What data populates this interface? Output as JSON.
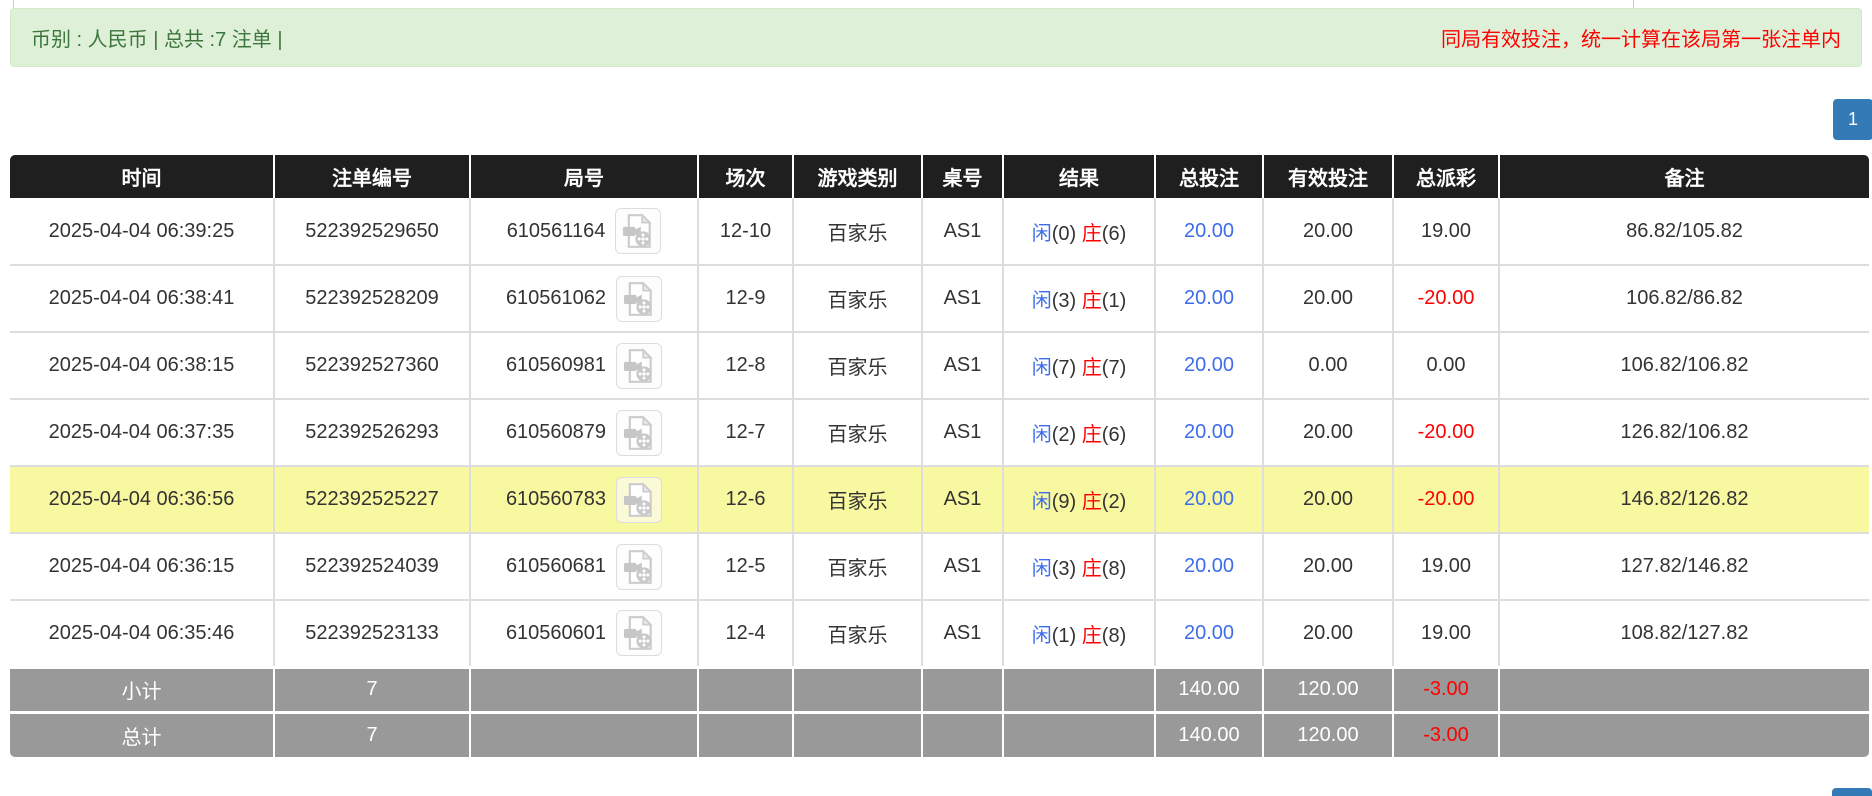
{
  "top_bar": {
    "left_text": "币别 : 人民币 | 总共 :7 注单 |",
    "right_text": "同局有效投注，统一计算在该局第一张注单内"
  },
  "pagination": {
    "current_page": "1"
  },
  "table": {
    "headers": [
      "时间",
      "注单编号",
      "局号",
      "场次",
      "游戏类别",
      "桌号",
      "结果",
      "总投注",
      "有效投注",
      "总派彩",
      "备注"
    ],
    "result_labels": {
      "player": "闲",
      "banker": "庄"
    },
    "rows": [
      {
        "time": "2025-04-04 06:39:25",
        "bet_id": "522392529650",
        "round_id": "610561164",
        "session": "12-10",
        "game_type": "百家乐",
        "table_no": "AS1",
        "player_points": "0",
        "banker_points": "6",
        "total_bet": "20.00",
        "valid_bet": "20.00",
        "payout": "19.00",
        "note": "86.82/105.82",
        "highlighted": false
      },
      {
        "time": "2025-04-04 06:38:41",
        "bet_id": "522392528209",
        "round_id": "610561062",
        "session": "12-9",
        "game_type": "百家乐",
        "table_no": "AS1",
        "player_points": "3",
        "banker_points": "1",
        "total_bet": "20.00",
        "valid_bet": "20.00",
        "payout": "-20.00",
        "note": "106.82/86.82",
        "highlighted": false
      },
      {
        "time": "2025-04-04 06:38:15",
        "bet_id": "522392527360",
        "round_id": "610560981",
        "session": "12-8",
        "game_type": "百家乐",
        "table_no": "AS1",
        "player_points": "7",
        "banker_points": "7",
        "total_bet": "20.00",
        "valid_bet": "0.00",
        "payout": "0.00",
        "note": "106.82/106.82",
        "highlighted": false
      },
      {
        "time": "2025-04-04 06:37:35",
        "bet_id": "522392526293",
        "round_id": "610560879",
        "session": "12-7",
        "game_type": "百家乐",
        "table_no": "AS1",
        "player_points": "2",
        "banker_points": "6",
        "total_bet": "20.00",
        "valid_bet": "20.00",
        "payout": "-20.00",
        "note": "126.82/106.82",
        "highlighted": false
      },
      {
        "time": "2025-04-04 06:36:56",
        "bet_id": "522392525227",
        "round_id": "610560783",
        "session": "12-6",
        "game_type": "百家乐",
        "table_no": "AS1",
        "player_points": "9",
        "banker_points": "2",
        "total_bet": "20.00",
        "valid_bet": "20.00",
        "payout": "-20.00",
        "note": "146.82/126.82",
        "highlighted": true
      },
      {
        "time": "2025-04-04 06:36:15",
        "bet_id": "522392524039",
        "round_id": "610560681",
        "session": "12-5",
        "game_type": "百家乐",
        "table_no": "AS1",
        "player_points": "3",
        "banker_points": "8",
        "total_bet": "20.00",
        "valid_bet": "20.00",
        "payout": "19.00",
        "note": "127.82/146.82",
        "highlighted": false
      },
      {
        "time": "2025-04-04 06:35:46",
        "bet_id": "522392523133",
        "round_id": "610560601",
        "session": "12-4",
        "game_type": "百家乐",
        "table_no": "AS1",
        "player_points": "1",
        "banker_points": "8",
        "total_bet": "20.00",
        "valid_bet": "20.00",
        "payout": "19.00",
        "note": "108.82/127.82",
        "highlighted": false
      }
    ],
    "subtotal": {
      "label": "小计",
      "count": "7",
      "total_bet": "140.00",
      "valid_bet": "120.00",
      "payout": "-3.00"
    },
    "total": {
      "label": "总计",
      "count": "7",
      "total_bet": "140.00",
      "valid_bet": "120.00",
      "payout": "-3.00"
    }
  },
  "icons": {
    "round_video": "video-replay-icon"
  },
  "colors": {
    "alert_bg": "#dff0d8",
    "alert_border": "#d6e9c6",
    "alert_text_green": "#3c763d",
    "alert_text_red": "#ff0000",
    "header_bg": "#1f1f1f",
    "footer_bg": "#999999",
    "highlight_row": "#f8f8a0",
    "link_blue": "#3d6deb",
    "banker_red": "#ff0000",
    "pagination_blue": "#337ab7"
  }
}
